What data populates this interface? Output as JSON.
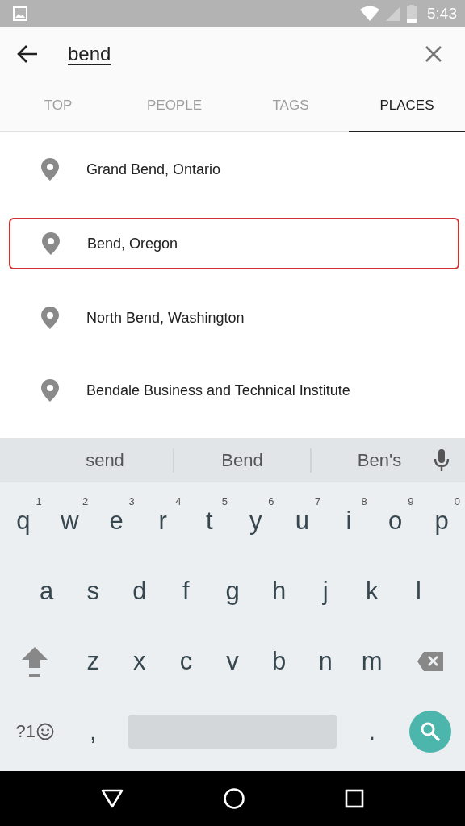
{
  "status_bar": {
    "time": "5:43"
  },
  "search": {
    "value": "bend"
  },
  "tabs": [
    {
      "label": "TOP",
      "selected": false
    },
    {
      "label": "PEOPLE",
      "selected": false
    },
    {
      "label": "TAGS",
      "selected": false
    },
    {
      "label": "PLACES",
      "selected": true
    }
  ],
  "places": [
    {
      "name": "Grand Bend, Ontario",
      "selected": false
    },
    {
      "name": "Bend, Oregon",
      "selected": true
    },
    {
      "name": "North Bend, Washington",
      "selected": false
    },
    {
      "name": "Bendale Business and Technical Institute",
      "selected": false
    }
  ],
  "keyboard": {
    "suggestions": [
      "send",
      "Bend",
      "Ben's"
    ],
    "rows": [
      {
        "keys": [
          {
            "kind": "letter",
            "label": "q",
            "hint": "1"
          },
          {
            "kind": "letter",
            "label": "w",
            "hint": "2"
          },
          {
            "kind": "letter",
            "label": "e",
            "hint": "3"
          },
          {
            "kind": "letter",
            "label": "r",
            "hint": "4"
          },
          {
            "kind": "letter",
            "label": "t",
            "hint": "5"
          },
          {
            "kind": "letter",
            "label": "y",
            "hint": "6"
          },
          {
            "kind": "letter",
            "label": "u",
            "hint": "7"
          },
          {
            "kind": "letter",
            "label": "i",
            "hint": "8"
          },
          {
            "kind": "letter",
            "label": "o",
            "hint": "9"
          },
          {
            "kind": "letter",
            "label": "p",
            "hint": "0"
          }
        ]
      },
      {
        "keys": [
          {
            "kind": "letter",
            "label": "a"
          },
          {
            "kind": "letter",
            "label": "s"
          },
          {
            "kind": "letter",
            "label": "d"
          },
          {
            "kind": "letter",
            "label": "f"
          },
          {
            "kind": "letter",
            "label": "g"
          },
          {
            "kind": "letter",
            "label": "h"
          },
          {
            "kind": "letter",
            "label": "j"
          },
          {
            "kind": "letter",
            "label": "k"
          },
          {
            "kind": "letter",
            "label": "l"
          }
        ]
      },
      {
        "keys": [
          {
            "kind": "shift"
          },
          {
            "kind": "letter",
            "label": "z"
          },
          {
            "kind": "letter",
            "label": "x"
          },
          {
            "kind": "letter",
            "label": "c"
          },
          {
            "kind": "letter",
            "label": "v"
          },
          {
            "kind": "letter",
            "label": "b"
          },
          {
            "kind": "letter",
            "label": "n"
          },
          {
            "kind": "letter",
            "label": "m"
          },
          {
            "kind": "backspace"
          }
        ]
      },
      {
        "keys": [
          {
            "kind": "symbols",
            "label": "?1"
          },
          {
            "kind": "letter",
            "label": ","
          },
          {
            "kind": "space"
          },
          {
            "kind": "letter",
            "label": "."
          },
          {
            "kind": "search"
          }
        ]
      }
    ]
  }
}
